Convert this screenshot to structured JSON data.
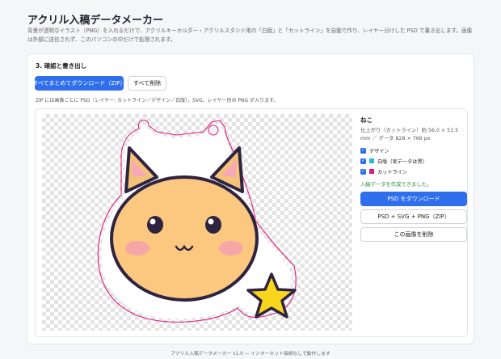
{
  "header": {
    "title": "アクリル入稿データメーカー",
    "description": "背景が透明なイラスト（PNG）を入れるだけで、アクリルキーホルダー・アクリルスタンド用の「白版」と「カットライン」を自動で作り、レイヤー分けした PSD で書き出します。画像は外部に送信されず、このパソコンの中だけで処理されます。"
  },
  "section": {
    "title": "3. 確認と書き出し",
    "download_all_label": "すべてまとめてダウンロード（ZIP）",
    "delete_all_label": "すべて削除",
    "zip_note": "ZIP には画像ごとに PSD（レイヤー: カットライン／デザイン／白版）、SVG、レイヤー別の PNG が入ります。"
  },
  "item": {
    "name": "ねこ",
    "size_text": "仕上がり（カットライン）約 56.0 × 51.5 mm ／ データ 828 × 766 px",
    "layers": [
      {
        "label": "デザイン",
        "checked": true,
        "color": ""
      },
      {
        "label": "白版（実データは黒）",
        "checked": true,
        "color": "#29b6e8"
      },
      {
        "label": "カットライン",
        "checked": true,
        "color": "#e0197d"
      }
    ],
    "status": "入稿データを作成できました。",
    "download_psd_label": "PSD をダウンロード",
    "download_bundle_label": "PSD + SVG + PNG（ZIP）",
    "delete_label": "この画像を削除"
  },
  "colors": {
    "accent": "#2f6fed",
    "cutline": "#e0197d",
    "white_plate": "#29b6e8",
    "success": "#2e8b3a"
  },
  "footer": {
    "text": "アクリル入稿データメーカー v1.0 — インターネット接続なしで動作します"
  }
}
